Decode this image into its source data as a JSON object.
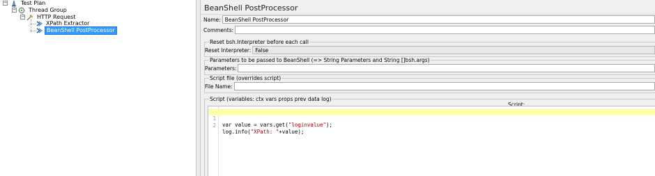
{
  "tree": {
    "items": [
      {
        "label": "Test Plan",
        "icon": "test-plan-icon",
        "expander": "−"
      },
      {
        "label": "Thread Group",
        "icon": "thread-group-icon",
        "expander": "−"
      },
      {
        "label": "HTTP Request",
        "icon": "http-request-icon",
        "expander": "−"
      },
      {
        "label": "XPath Extractor",
        "icon": "xpath-extractor-icon"
      },
      {
        "label": "BeanShell PostProcessor",
        "icon": "beanshell-postprocessor-icon",
        "selected": true
      }
    ]
  },
  "editor": {
    "title": "BeanShell PostProcessor",
    "name_label": "Name:",
    "name_value": "BeanShell PostProcessor",
    "comments_label": "Comments:",
    "comments_value": "",
    "reset_group_title": "Reset bsh.Interpreter before each call",
    "reset_label": "Reset Interpreter:",
    "reset_value": "False",
    "params_group_title": "Parameters to be passed to BeanShell (=> String Parameters and String []bsh.args)",
    "params_label": "Parameters:",
    "params_value": "",
    "file_group_title": "Script file (overrides script)",
    "file_label": "File Name:",
    "file_value": "",
    "script_group_title": "Script (variables: ctx vars props prev data log)",
    "script_header": "Script:",
    "script_lines": [
      {
        "num": "1",
        "code_before": "var value = vars.get(",
        "string": "\"loginvalue\"",
        "code_after": ");"
      },
      {
        "num": "2",
        "code_before": "log.info(",
        "string": "\"XPath: \"",
        "code_after": "+value);"
      }
    ]
  },
  "colors": {
    "selection": "#3399ff",
    "current_line": "#ffffa8",
    "string_literal": "#c00000"
  }
}
